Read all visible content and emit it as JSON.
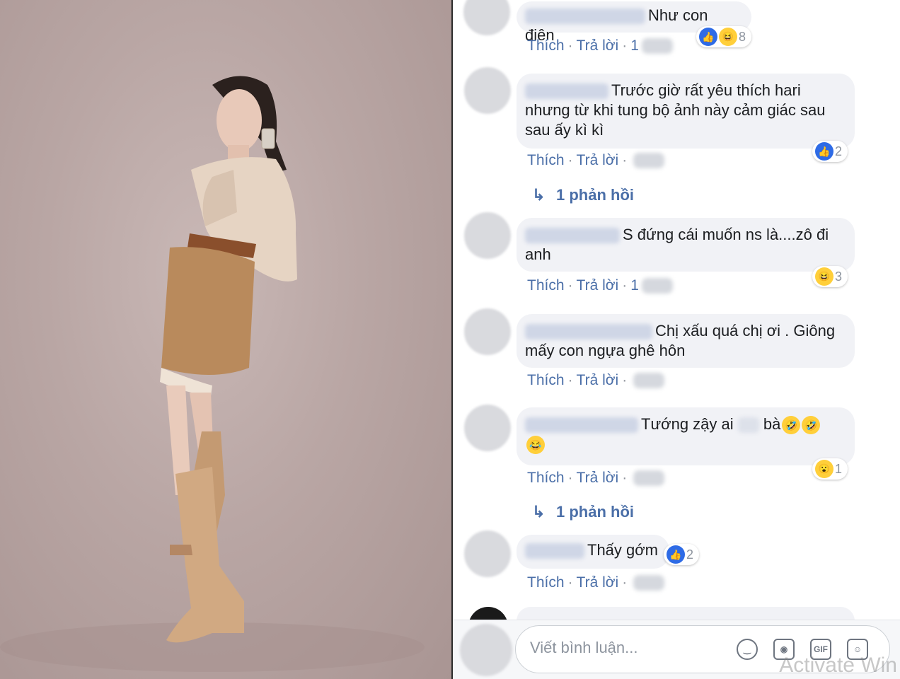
{
  "comments": [
    {
      "text": "Như con điên",
      "reactions": {
        "count": "8"
      },
      "actions": {
        "like": "Thích",
        "reply": "Trả lời",
        "time": "1"
      }
    },
    {
      "text": "Trước giờ rất yêu thích hari nhưng từ khi tung bộ ảnh này cảm giác sau sau ấy kì kì",
      "reactions": {
        "count": "2"
      },
      "actions": {
        "like": "Thích",
        "reply": "Trả lời"
      },
      "replies": "1 phản hồi"
    },
    {
      "text": "S đứng cái muốn ns là....zô đi anh",
      "reactions": {
        "count": "3"
      },
      "actions": {
        "like": "Thích",
        "reply": "Trả lời",
        "time": "1"
      }
    },
    {
      "text": "Chị xấu quá chị ơi . Giông mấy con ngựa ghê hôn",
      "actions": {
        "like": "Thích",
        "reply": "Trả lời"
      }
    },
    {
      "text": "Tướng zậy ai",
      "text2": "bà",
      "reactions": {
        "count": "1"
      },
      "actions": {
        "like": "Thích",
        "reply": "Trả lời"
      },
      "replies": "1 phản hồi"
    },
    {
      "text": "Thấy gớm",
      "reactions": {
        "count": "2"
      },
      "actions": {
        "like": "Thích",
        "reply": "Trả lời"
      }
    }
  ],
  "composer": {
    "placeholder": "Viết bình luận..."
  },
  "icons": {
    "emoji": "smiley-icon",
    "camera": "camera-icon",
    "gif": "gif-icon",
    "sticker": "sticker-icon"
  },
  "watermark": "Activate Win"
}
